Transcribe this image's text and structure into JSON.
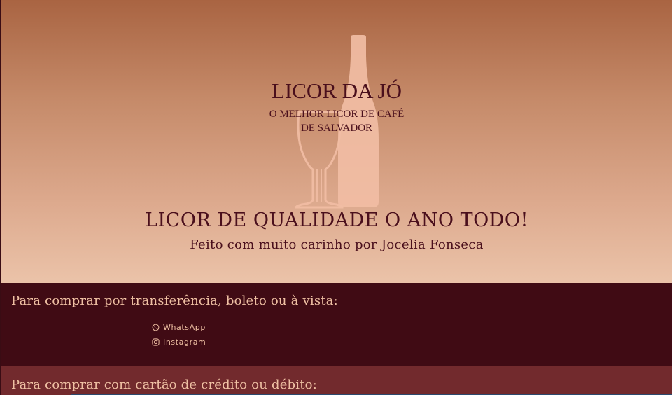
{
  "hero": {
    "brand_title": "LICOR DA JÓ",
    "brand_sub_line1": "O MELHOR LICOR DE CAFÉ",
    "brand_sub_line2": "DE SALVADOR",
    "headline": "LICOR DE QUALIDADE O ANO TODO!",
    "tagline": "Feito com muito carinho por Jocelia Fonseca"
  },
  "purchase_transfer": {
    "title": "Para comprar por transferência, boleto ou à vista:",
    "links": [
      {
        "label": "WhatsApp",
        "icon": "whatsapp-icon"
      },
      {
        "label": "Instagram",
        "icon": "instagram-icon"
      }
    ]
  },
  "purchase_card": {
    "title": "Para comprar com cartão de crédito ou débito:"
  },
  "colors": {
    "hero_top": "#a96442",
    "hero_bottom": "#ebc3a9",
    "dark_section": "#400b14",
    "red_section": "#722a2d",
    "accent_text": "#efc0a3",
    "brand_text": "#4a0f1c",
    "logo_fill": "#f1bda4"
  }
}
